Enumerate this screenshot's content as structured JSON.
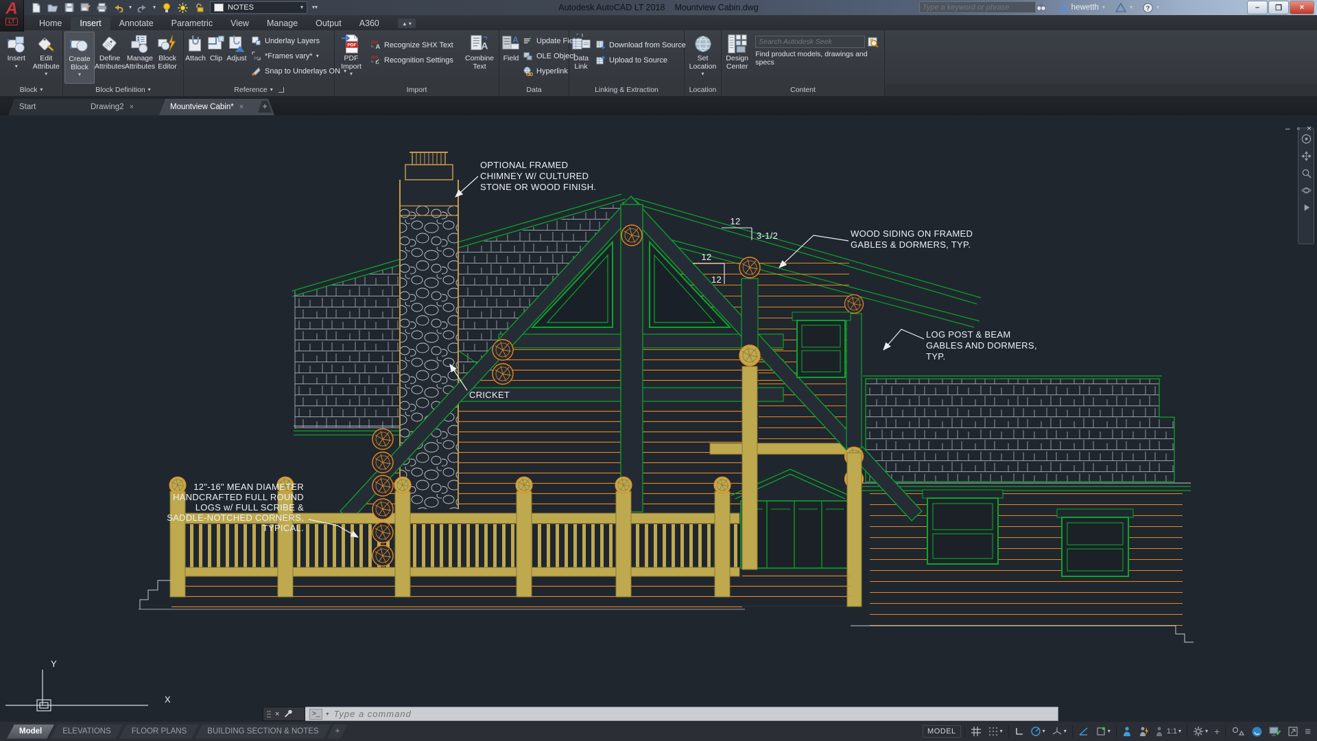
{
  "title_bar": {
    "app_title": "Autodesk AutoCAD LT 2018",
    "doc_title": "Mountview Cabin.dwg",
    "search_placeholder": "Type a keyword or phrase",
    "user_name": "hewetth",
    "layer_name": "NOTES"
  },
  "ribbon": {
    "tabs": [
      "Home",
      "Insert",
      "Annotate",
      "Parametric",
      "View",
      "Manage",
      "Output",
      "A360"
    ],
    "active_tab": "Insert",
    "block_panel": {
      "label": "Block",
      "insert": "Insert",
      "edit_attribute": "Edit\nAttribute"
    },
    "block_def_panel": {
      "label": "Block Definition",
      "create_block": "Create\nBlock",
      "define_attributes": "Define\nAttributes",
      "manage_attributes": "Manage\nAttributes",
      "block_editor": "Block\nEditor"
    },
    "reference_panel": {
      "label": "Reference",
      "attach": "Attach",
      "clip": "Clip",
      "adjust": "Adjust",
      "underlay_layers": "Underlay Layers",
      "frames": "*Frames vary*",
      "snap_underlays": "Snap to Underlays ON"
    },
    "import_panel": {
      "label": "Import",
      "pdf_import": "PDF\nImport",
      "recognize_shx": "Recognize SHX Text",
      "recognition_settings": "Recognition Settings",
      "combine_text": "Combine\nText"
    },
    "data_panel": {
      "label": "Data",
      "field": "Field",
      "update_fields": "Update Fields",
      "ole_object": "OLE Object",
      "hyperlink": "Hyperlink"
    },
    "linking_panel": {
      "label": "Linking & Extraction",
      "data_link": "Data\nLink",
      "download": "Download from Source",
      "upload": "Upload to Source"
    },
    "location_panel": {
      "label": "Location",
      "set_location": "Set\nLocation"
    },
    "content_panel": {
      "label": "Content",
      "design_center": "Design\nCenter",
      "seek_placeholder": "Search Autodesk Seek",
      "seek_hint": "Find product models, drawings and specs"
    }
  },
  "file_tabs": {
    "start": "Start",
    "drawing2": "Drawing2",
    "active_doc": "Mountview Cabin*"
  },
  "drawing": {
    "annotations": {
      "chimney": [
        "OPTIONAL FRAMED",
        "CHIMNEY W/ CULTURED",
        "STONE OR WOOD FINISH."
      ],
      "siding": [
        "WOOD SIDING ON FRAMED",
        "GABLES & DORMERS, TYP."
      ],
      "logpost": [
        "LOG POST & BEAM",
        "GABLES AND DORMERS,",
        "TYP."
      ],
      "logs": [
        "12\"-16\" MEAN DIAMETER",
        "HANDCRAFTED FULL ROUND",
        "LOGS w/ FULL SCRIBE &",
        "SADDLE-NOTCHED CORNERS,",
        "TYPICAL."
      ],
      "cricket": "CRICKET",
      "slope1_rise": "12",
      "slope1_run": "3-1/2",
      "slope2_rise": "12",
      "slope2_run": "12",
      "ucs_x": "X",
      "ucs_y": "Y"
    }
  },
  "command_line": {
    "placeholder": "Type a command"
  },
  "layout_tabs": {
    "model": "Model",
    "t1": "ELEVATIONS",
    "t2": "FLOOR PLANS",
    "t3": "BUILDING SECTION & NOTES"
  },
  "status_bar": {
    "model_label": "MODEL",
    "annotation_scale": "1:1",
    "icons": [
      "grid-display-icon",
      "snap-mode-icon",
      "ortho-icon",
      "polar-tracking-icon",
      "isodraft-icon",
      "autosnap-icon",
      "object-snap-icon",
      "annotation-visibility-icon",
      "annotation-autoscale-icon",
      "annotation-scale-icon",
      "workspace-gear-icon",
      "customize-plus-icon",
      "isolate-objects-icon",
      "graphics-performance-icon",
      "system-monitor-icon",
      "clean-screen-icon",
      "menu-icon"
    ]
  },
  "colors": {
    "accent_blue": "#3f9bdc",
    "cad_orange": "#e8871e",
    "cad_green": "#0aa62a",
    "cad_tan": "#bfa94f",
    "pdf_red": "#c6281e",
    "annotation_white": "#eef1f4"
  }
}
